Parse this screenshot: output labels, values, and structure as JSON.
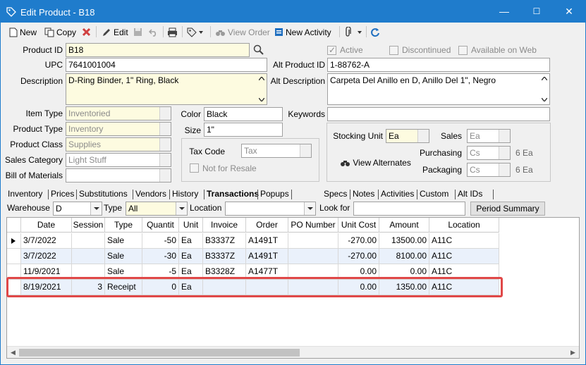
{
  "window": {
    "title": "Edit Product - B18",
    "minimize": "—",
    "maximize": "☐",
    "close": "✕"
  },
  "toolbar": {
    "new_label": "New",
    "copy_label": "Copy",
    "edit_label": "Edit",
    "view_order_label": "View Order",
    "new_activity_label": "New Activity"
  },
  "product": {
    "product_id_label": "Product ID",
    "product_id": "B18",
    "upc_label": "UPC",
    "upc": "7641001004",
    "description_label": "Description",
    "description": "D-Ring Binder, 1\" Ring, Black",
    "alt_product_id_label": "Alt Product ID",
    "alt_product_id": "1-88762-A",
    "alt_description_label": "Alt Description",
    "alt_description": "Carpeta Del Anillo en D, Anillo Del 1\", Negro",
    "active_label": "Active",
    "discontinued_label": "Discontinued",
    "available_on_web_label": "Available on Web",
    "item_type_label": "Item Type",
    "item_type": "Inventoried",
    "product_type_label": "Product Type",
    "product_type": "Inventory",
    "product_class_label": "Product Class",
    "product_class": "Supplies",
    "sales_category_label": "Sales Category",
    "sales_category": "Light Stuff",
    "bill_of_materials_label": "Bill of Materials",
    "bill_of_materials": "",
    "color_label": "Color",
    "color": "Black",
    "size_label": "Size",
    "size": "1\"",
    "keywords_label": "Keywords",
    "keywords": "",
    "tax_code_label": "Tax Code",
    "tax_code": "Tax",
    "not_for_resale_label": "Not for Resale",
    "stocking_unit_label": "Stocking Unit",
    "stocking_unit": "Ea",
    "sales_label": "Sales",
    "sales_unit": "Ea",
    "purchasing_label": "Purchasing",
    "purchasing_unit": "Cs",
    "purchasing_qty": "6 Ea",
    "packaging_label": "Packaging",
    "packaging_unit": "Cs",
    "packaging_qty": "6 Ea",
    "view_alternates_label": "View Alternates"
  },
  "tabs_left": [
    "Inventory",
    "Prices",
    "Substitutions",
    "Vendors",
    "History",
    "Transactions",
    "Popups"
  ],
  "tabs_right": [
    "Specs",
    "Notes",
    "Activities",
    "Custom",
    "Alt IDs"
  ],
  "filters": {
    "warehouse_label": "Warehouse",
    "warehouse": "D",
    "type_label": "Type",
    "type": "All",
    "location_label": "Location",
    "location": "",
    "look_for_label": "Look for",
    "look_for": "",
    "period_summary_label": "Period Summary"
  },
  "grid": {
    "columns": [
      "Date",
      "Session",
      "Type",
      "Quantit",
      "Unit",
      "Invoice",
      "Order",
      "PO Number",
      "Unit Cost",
      "Amount",
      "Location"
    ],
    "rows": [
      [
        "3/7/2022",
        "",
        "Sale",
        "-50",
        "Ea",
        "B3337Z",
        "A1491T",
        "",
        "-270.00",
        "13500.00",
        "A11C"
      ],
      [
        "3/7/2022",
        "",
        "Sale",
        "-30",
        "Ea",
        "B3337Z",
        "A1491T",
        "",
        "-270.00",
        "8100.00",
        "A11C"
      ],
      [
        "11/9/2021",
        "",
        "Sale",
        "-5",
        "Ea",
        "B3328Z",
        "A1477T",
        "",
        "0.00",
        "0.00",
        "A11C"
      ],
      [
        "8/19/2021",
        "3",
        "Receipt",
        "0",
        "Ea",
        "",
        "",
        "",
        "0.00",
        "1350.00",
        "A11C"
      ]
    ]
  }
}
